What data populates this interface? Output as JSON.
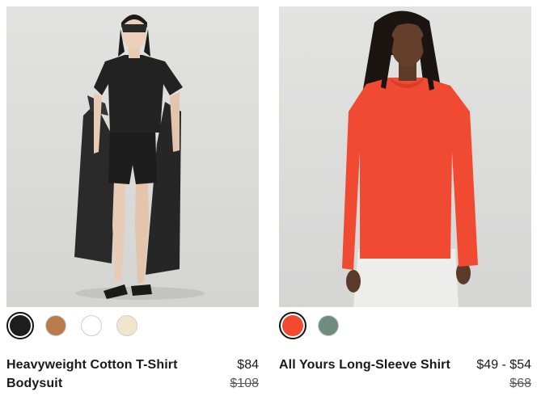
{
  "products": [
    {
      "name": "Heavyweight Cotton T-Shirt Bodysuit",
      "price": "$84",
      "original_price": "$108",
      "image_alt": "Model wearing black t-shirt bodysuit with black trench coat",
      "swatches": [
        {
          "color": "#1e1e1e",
          "selected": true
        },
        {
          "color": "#b97a4c",
          "selected": false
        },
        {
          "color": "#ffffff",
          "selected": false
        },
        {
          "color": "#efe6cc",
          "selected": false
        }
      ]
    },
    {
      "name": "All Yours Long-Sleeve Shirt",
      "price": "$49 - $54",
      "original_price": "$68",
      "image_alt": "Model wearing coral long-sleeve shirt with white pants",
      "swatches": [
        {
          "color": "#f24a32",
          "selected": true
        },
        {
          "color": "#6f8c80",
          "selected": false
        }
      ]
    }
  ]
}
